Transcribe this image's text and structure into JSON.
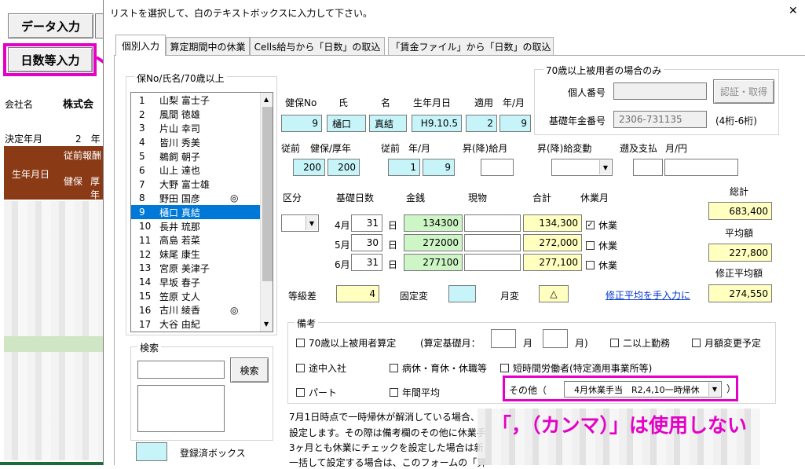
{
  "excel": {
    "btn_data_entry": "データ入力",
    "btn_days_entry": "日数等入力",
    "company_label": "会社名",
    "company_name": "株式会",
    "decision_label": "決定年月",
    "decision_month": "2　年",
    "header_prev": "従前報酬",
    "header_birth": "生年月日",
    "header_kenpo": "健保",
    "header_kosei": "厚年"
  },
  "dialog": {
    "title": "リストを選択して、白のテキストボックスに入力して下さい。",
    "close": "✕",
    "tabs": [
      "個別入力",
      "算定期間中の休業",
      "Cells給与から「日数」の取込",
      "「賃金ファイル」から「日数」の取込"
    ]
  },
  "list": {
    "group_label": "保No/氏名/70歳以上",
    "items": [
      {
        "no": "1",
        "name": "山梨 富士子",
        "mark": ""
      },
      {
        "no": "2",
        "name": "風間 徳雄",
        "mark": ""
      },
      {
        "no": "3",
        "name": "片山 幸司",
        "mark": ""
      },
      {
        "no": "4",
        "name": "皆川 秀美",
        "mark": ""
      },
      {
        "no": "5",
        "name": "鵜飼 朝子",
        "mark": ""
      },
      {
        "no": "6",
        "name": "山上 達也",
        "mark": ""
      },
      {
        "no": "7",
        "name": "大野 富士雄",
        "mark": ""
      },
      {
        "no": "8",
        "name": "野田 国彦",
        "mark": "◎"
      },
      {
        "no": "9",
        "name": "樋口 真結",
        "mark": ""
      },
      {
        "no": "10",
        "name": "長井 琉那",
        "mark": ""
      },
      {
        "no": "11",
        "name": "高島 若菜",
        "mark": ""
      },
      {
        "no": "12",
        "name": "妹尾 康生",
        "mark": ""
      },
      {
        "no": "13",
        "name": "宮原 美津子",
        "mark": ""
      },
      {
        "no": "14",
        "name": "早坂 春子",
        "mark": ""
      },
      {
        "no": "15",
        "name": "笠原 丈人",
        "mark": ""
      },
      {
        "no": "16",
        "name": "古川 綾香",
        "mark": "◎"
      },
      {
        "no": "17",
        "name": "大谷 由紀",
        "mark": ""
      }
    ],
    "search_label": "検索",
    "search_button": "検索",
    "search_value": "",
    "registered_label": "登録済ボックス"
  },
  "over70": {
    "group_label": "70歳以上被用者の場合のみ",
    "personal_no_label": "個人番号",
    "personal_no_value": "",
    "auth_button": "認証・取得",
    "pension_no_label": "基礎年金番号",
    "pension_no_value": "2306-731135",
    "pension_no_hint": "(4桁-6桁)"
  },
  "form": {
    "h_kenpo_no": "健保No",
    "h_shi": "氏",
    "h_mei": "名",
    "h_birth": "生年月日",
    "h_apply": "適用",
    "h_ym": "年/月",
    "kenpo_no": "9",
    "shi": "樋口",
    "mei": "真結",
    "birth": "H9.10.5",
    "apply_y": "2",
    "apply_m": "9",
    "l_prev": "従前",
    "l_kenpo_kosei": "健保/厚年",
    "l_prev2": "従前",
    "l_ym2": "年/月",
    "l_raise_pay": "昇(降)給月",
    "l_raise_change": "昇(降)給変動",
    "l_retro": "遡及支払",
    "l_ym3": "月/円",
    "prev_kenpo": "200",
    "prev_kosei": "200",
    "prev_y": "1",
    "prev_m": "9",
    "raise_month": "",
    "raise_change": "",
    "retro_m": "",
    "retro_yen": "",
    "l_kubun": "区分",
    "l_base_days": "基礎日数",
    "l_money": "金銭",
    "l_goods": "現物",
    "l_total": "合計",
    "l_leave": "休業月",
    "l_sum": "総計",
    "l_avg": "平均額",
    "l_mod_avg": "修正平均額",
    "day_unit": "日",
    "leave_label": "休業",
    "months": [
      {
        "m": "4月",
        "days": "31",
        "money": "134300",
        "goods": "",
        "total": "134,300",
        "leave": true
      },
      {
        "m": "5月",
        "days": "30",
        "money": "272000",
        "goods": "",
        "total": "272,000",
        "leave": false
      },
      {
        "m": "6月",
        "days": "31",
        "money": "277100",
        "goods": "",
        "total": "277,100",
        "leave": false
      }
    ],
    "sum": "683,400",
    "avg": "227,800",
    "mod_avg": "274,550",
    "l_grade_diff": "等級差",
    "grade_diff": "4",
    "l_fixed_change": "固定変",
    "fixed_change": "",
    "l_month_change": "月変",
    "month_change": "△",
    "manual_link": "修正平均を手入力に"
  },
  "remarks": {
    "group_label": "備考",
    "cb_over70": "70歳以上被用者算定",
    "base_month_label": "(算定基礎月：",
    "month_unit": "月",
    "month_close": "月)",
    "cb_two_jobs": "二以上勤務",
    "cb_change_plan": "月額変更予定",
    "cb_midjoin": "途中入社",
    "cb_sick_leave": "病休・育休・休職等",
    "cb_short_time": "短時間労働者(特定適用事業所等)",
    "cb_part": "パート",
    "cb_annual_avg": "年間平均",
    "other_label": "その他（",
    "other_value": "4月休業手当　R2,4,10一時帰休",
    "other_close": "）"
  },
  "footer": {
    "line1": "7月1日時点で一時帰休が解消している場合、",
    "line2": "設定します。その際は備考欄のその他に休業手",
    "line3": "3ヶ月とも休業にチェックを設定した場合は新",
    "line4": "一括して設定する場合は、このフォームの「算"
  },
  "annotation": {
    "text": "「，（カンマ）」は使用しない",
    "color": "#e400c8"
  },
  "colors": {
    "cyan": "#c6f4f8",
    "yellow": "#ffffc0",
    "green": "#cdf5c5",
    "select": "#0078d7",
    "link": "#0033cc",
    "magenta": "#e400c8",
    "excel_header": "#8b3a16"
  }
}
